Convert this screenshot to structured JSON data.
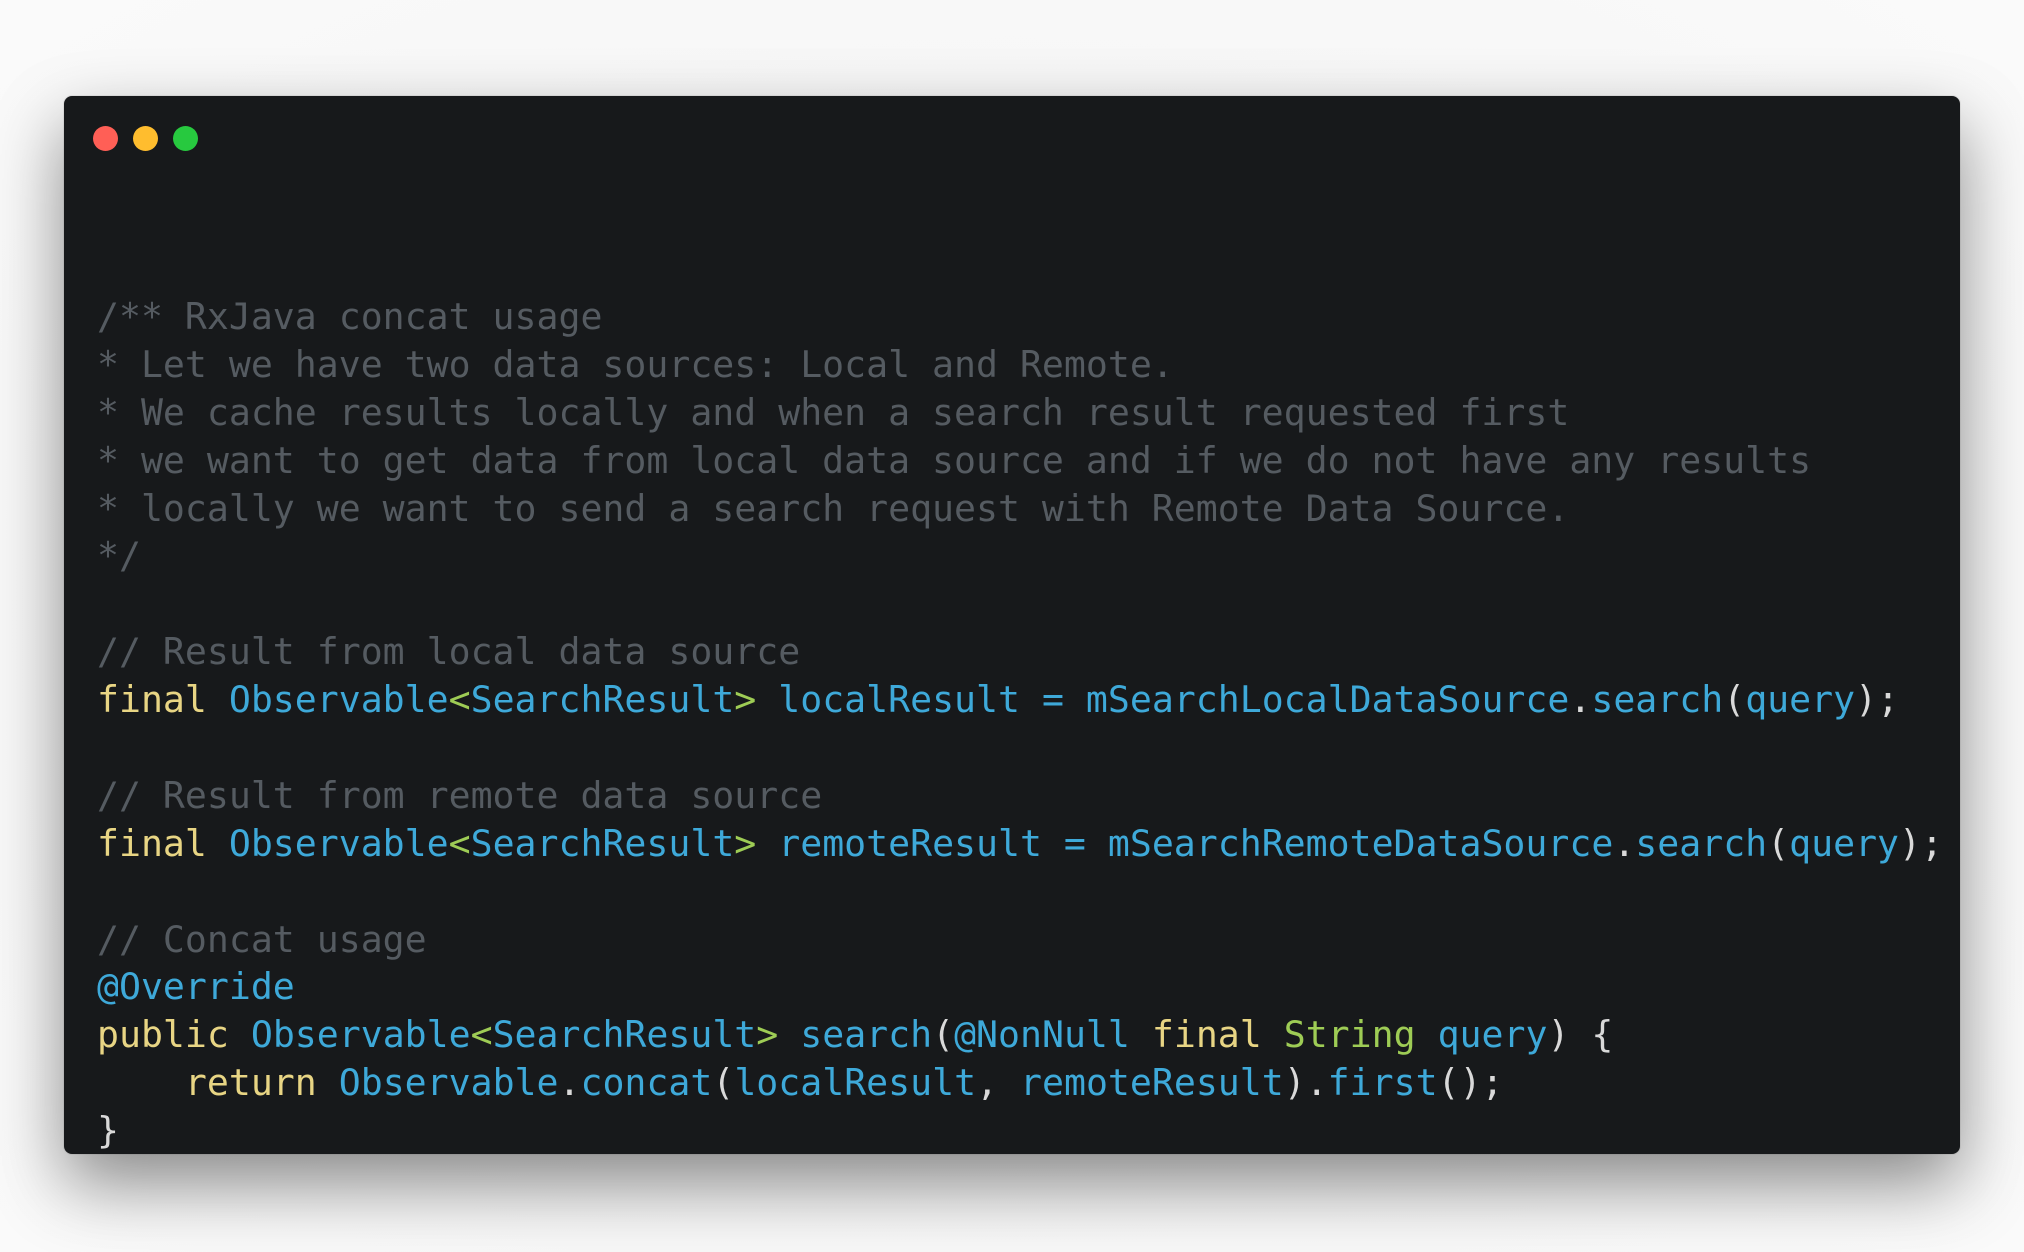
{
  "colors": {
    "window_background": "#17191b",
    "close": "#ff5f56",
    "minimize": "#ffbd2e",
    "maximize": "#27c93f",
    "comment": "#555b61",
    "keyword": "#e8d584",
    "identifier": "#3ea9d9",
    "generic_bracket": "#9ecc55",
    "plain": "#d9d9d9"
  },
  "window_controls": [
    "close",
    "minimize",
    "maximize"
  ],
  "code_lines": [
    [
      {
        "t": "/** RxJava concat usage",
        "c": "cm"
      }
    ],
    [
      {
        "t": "* Let we have two data sources: Local and Remote.",
        "c": "cm"
      }
    ],
    [
      {
        "t": "* We cache results locally and when a search result requested first",
        "c": "cm"
      }
    ],
    [
      {
        "t": "* we want to get data from local data source and if we do not have any results",
        "c": "cm"
      }
    ],
    [
      {
        "t": "* locally we want to send a search request with Remote Data Source.",
        "c": "cm"
      }
    ],
    [
      {
        "t": "*/",
        "c": "cm"
      }
    ],
    [],
    [
      {
        "t": "// Result from local data source",
        "c": "cm"
      }
    ],
    [
      {
        "t": "final",
        "c": "kw"
      },
      {
        "t": " ",
        "c": "tx"
      },
      {
        "t": "Observable",
        "c": "ty"
      },
      {
        "t": "<",
        "c": "pu"
      },
      {
        "t": "SearchResult",
        "c": "ty"
      },
      {
        "t": ">",
        "c": "pu"
      },
      {
        "t": " localResult = mSearchLocalDataSource",
        "c": "id"
      },
      {
        "t": ".",
        "c": "tx"
      },
      {
        "t": "search",
        "c": "id"
      },
      {
        "t": "(",
        "c": "tx"
      },
      {
        "t": "query",
        "c": "id"
      },
      {
        "t": ");",
        "c": "tx"
      }
    ],
    [],
    [
      {
        "t": "// Result from remote data source",
        "c": "cm"
      }
    ],
    [
      {
        "t": "final",
        "c": "kw"
      },
      {
        "t": " ",
        "c": "tx"
      },
      {
        "t": "Observable",
        "c": "ty"
      },
      {
        "t": "<",
        "c": "pu"
      },
      {
        "t": "SearchResult",
        "c": "ty"
      },
      {
        "t": ">",
        "c": "pu"
      },
      {
        "t": " remoteResult = mSearchRemoteDataSource",
        "c": "id"
      },
      {
        "t": ".",
        "c": "tx"
      },
      {
        "t": "search",
        "c": "id"
      },
      {
        "t": "(",
        "c": "tx"
      },
      {
        "t": "query",
        "c": "id"
      },
      {
        "t": ");",
        "c": "tx"
      }
    ],
    [],
    [
      {
        "t": "// Concat usage",
        "c": "cm"
      }
    ],
    [
      {
        "t": "@Override",
        "c": "id"
      }
    ],
    [
      {
        "t": "public",
        "c": "kw"
      },
      {
        "t": " ",
        "c": "tx"
      },
      {
        "t": "Observable",
        "c": "ty"
      },
      {
        "t": "<",
        "c": "pu"
      },
      {
        "t": "SearchResult",
        "c": "ty"
      },
      {
        "t": ">",
        "c": "pu"
      },
      {
        "t": " search",
        "c": "id"
      },
      {
        "t": "(",
        "c": "tx"
      },
      {
        "t": "@NonNull",
        "c": "id"
      },
      {
        "t": " ",
        "c": "tx"
      },
      {
        "t": "final",
        "c": "kw"
      },
      {
        "t": " ",
        "c": "tx"
      },
      {
        "t": "String",
        "c": "st"
      },
      {
        "t": " ",
        "c": "tx"
      },
      {
        "t": "query",
        "c": "id"
      },
      {
        "t": ") {",
        "c": "tx"
      }
    ],
    [
      {
        "t": "    ",
        "c": "tx"
      },
      {
        "t": "return",
        "c": "kw"
      },
      {
        "t": " ",
        "c": "tx"
      },
      {
        "t": "Observable",
        "c": "ty"
      },
      {
        "t": ".",
        "c": "tx"
      },
      {
        "t": "concat",
        "c": "id"
      },
      {
        "t": "(",
        "c": "tx"
      },
      {
        "t": "localResult",
        "c": "id"
      },
      {
        "t": ", ",
        "c": "tx"
      },
      {
        "t": "remoteResult",
        "c": "id"
      },
      {
        "t": ").",
        "c": "tx"
      },
      {
        "t": "first",
        "c": "id"
      },
      {
        "t": "();",
        "c": "tx"
      }
    ],
    [
      {
        "t": "}",
        "c": "tx"
      }
    ]
  ]
}
